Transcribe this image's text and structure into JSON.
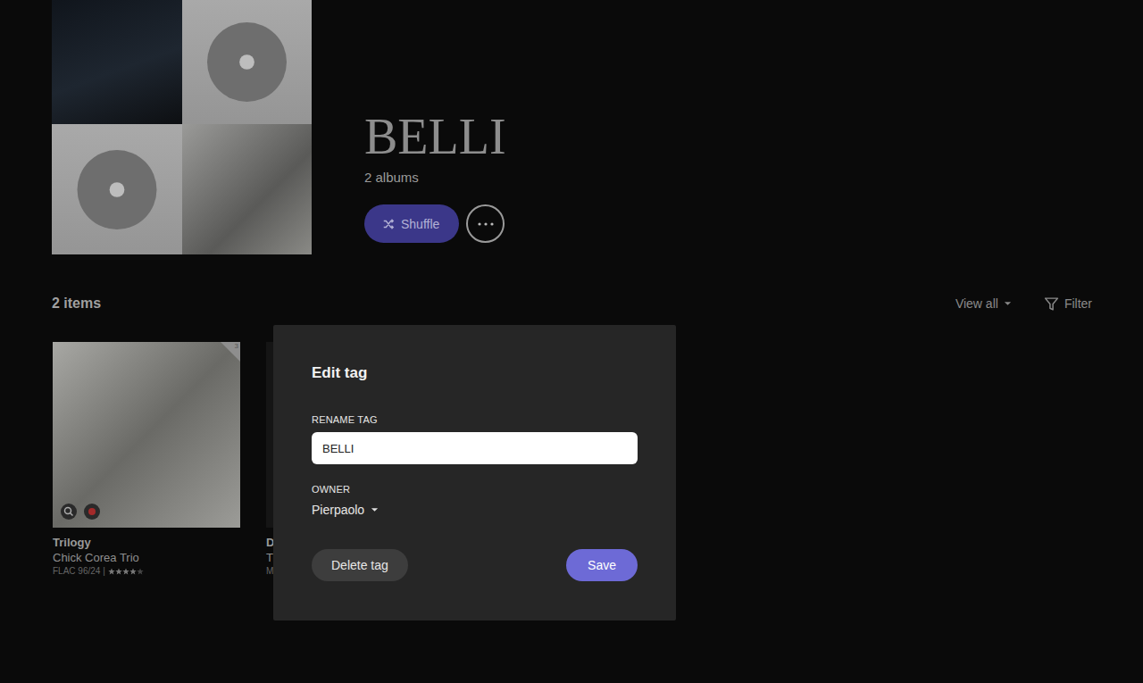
{
  "collage": [
    {
      "kind": "portrait"
    },
    {
      "kind": "disc"
    },
    {
      "kind": "disc"
    },
    {
      "kind": "cover"
    }
  ],
  "header": {
    "title": "BELLI",
    "subtitle": "2 albums",
    "shuffle": "Shuffle"
  },
  "items_bar": {
    "count": "2 items",
    "view": "View all",
    "filter": "Filter"
  },
  "albums": [
    {
      "title": "Trilogy",
      "artist": "Chick Corea Trio",
      "meta": "FLAC 96/24 | ",
      "stars": 4,
      "corner": "3",
      "covered": false
    },
    {
      "title": "D",
      "artist": "T",
      "meta": "M",
      "covered": true
    }
  ],
  "modal": {
    "title": "Edit tag",
    "rename_label": "RENAME TAG",
    "rename_value": "BELLI",
    "owner_label": "OWNER",
    "owner_value": "Pierpaolo",
    "buttons": [
      {
        "label": "Delete tag",
        "primary": false
      },
      {
        "label": "Save",
        "primary": true
      }
    ]
  }
}
